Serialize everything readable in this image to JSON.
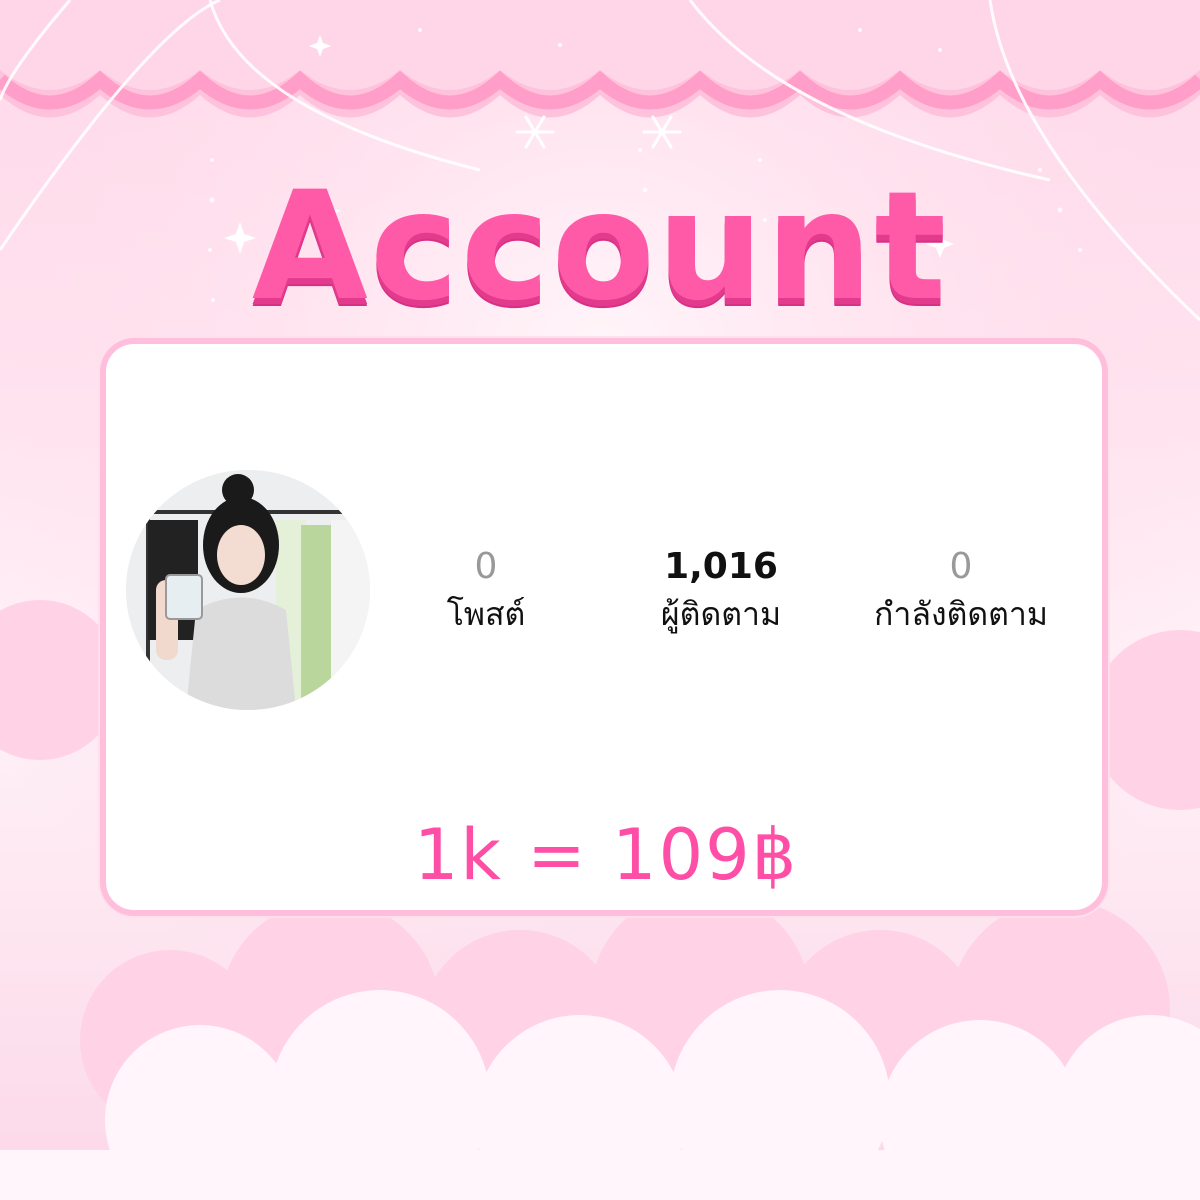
{
  "title": "Account",
  "profile": {
    "avatar_icon": "profile-photo",
    "stats": [
      {
        "value": "0",
        "label": "โพสต์"
      },
      {
        "value": "1,016",
        "label": "ผู้ติดตาม"
      },
      {
        "value": "0",
        "label": "กำลังติดตาม"
      }
    ]
  },
  "price": "1k = 109฿",
  "colors": {
    "accent": "#ff5aa8",
    "accent_shadow": "#e23a8c",
    "card_border": "#ffbfdc",
    "background": "#ffe3ef"
  }
}
